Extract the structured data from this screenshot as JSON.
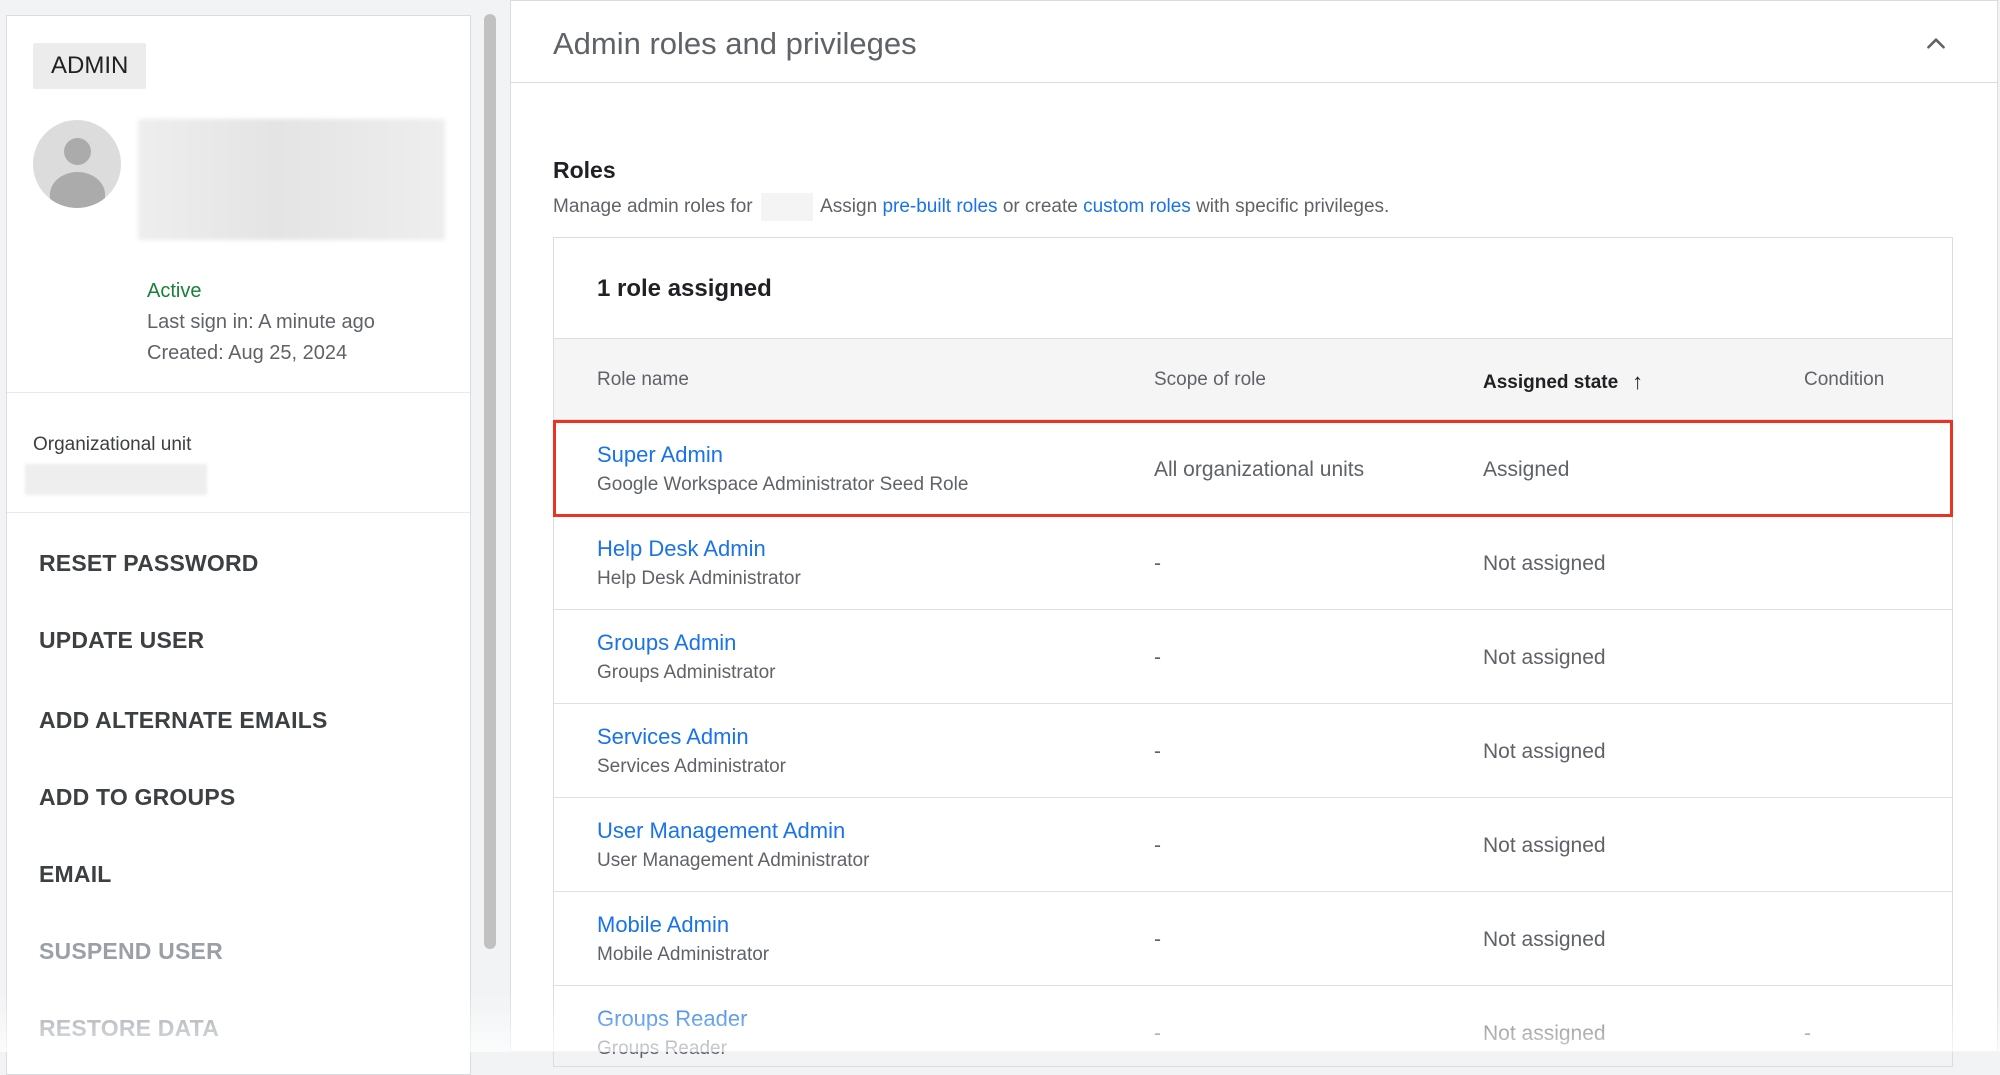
{
  "user_card": {
    "badge": "ADMIN",
    "status": "Active",
    "last_sign_in": "Last sign in: A minute ago",
    "created": "Created: Aug 25, 2024",
    "org_unit_label": "Organizational unit"
  },
  "actions": [
    {
      "label": "RESET PASSWORD",
      "enabled": true
    },
    {
      "label": "UPDATE USER",
      "enabled": true
    },
    {
      "label": "ADD ALTERNATE EMAILS",
      "enabled": true
    },
    {
      "label": "ADD TO GROUPS",
      "enabled": true
    },
    {
      "label": "EMAIL",
      "enabled": true
    },
    {
      "label": "SUSPEND USER",
      "enabled": false
    },
    {
      "label": "RESTORE DATA",
      "enabled": false
    }
  ],
  "section": {
    "title": "Admin roles and privileges",
    "collapse_icon": "chevron-up-icon"
  },
  "roles": {
    "heading": "Roles",
    "desc_prefix": "Manage admin roles for",
    "desc_assign": "Assign",
    "link_prebuilt": "pre-built roles",
    "desc_or": "or create",
    "link_custom": "custom roles",
    "desc_suffix": "with specific privileges.",
    "count": "1 role assigned",
    "columns": {
      "role_name": "Role name",
      "scope": "Scope of role",
      "assigned_state": "Assigned state",
      "condition": "Condition"
    },
    "sort_icon": "arrow-up-icon",
    "rows": [
      {
        "name": "Super Admin",
        "desc": "Google Workspace Administrator Seed Role",
        "scope": "All organizational units",
        "state": "Assigned",
        "condition": ""
      },
      {
        "name": "Help Desk Admin",
        "desc": "Help Desk Administrator",
        "scope": "-",
        "state": "Not assigned",
        "condition": ""
      },
      {
        "name": "Groups Admin",
        "desc": "Groups Administrator",
        "scope": "-",
        "state": "Not assigned",
        "condition": ""
      },
      {
        "name": "Services Admin",
        "desc": "Services Administrator",
        "scope": "-",
        "state": "Not assigned",
        "condition": ""
      },
      {
        "name": "User Management Admin",
        "desc": "User Management Administrator",
        "scope": "-",
        "state": "Not assigned",
        "condition": ""
      },
      {
        "name": "Mobile Admin",
        "desc": "Mobile Administrator",
        "scope": "-",
        "state": "Not assigned",
        "condition": ""
      },
      {
        "name": "Groups Reader",
        "desc": "Groups Reader",
        "scope": "-",
        "state": "Not assigned",
        "condition": "-"
      }
    ]
  },
  "colors": {
    "link": "#1a73e8",
    "active_status": "#188038",
    "highlight": "#ea3323"
  }
}
